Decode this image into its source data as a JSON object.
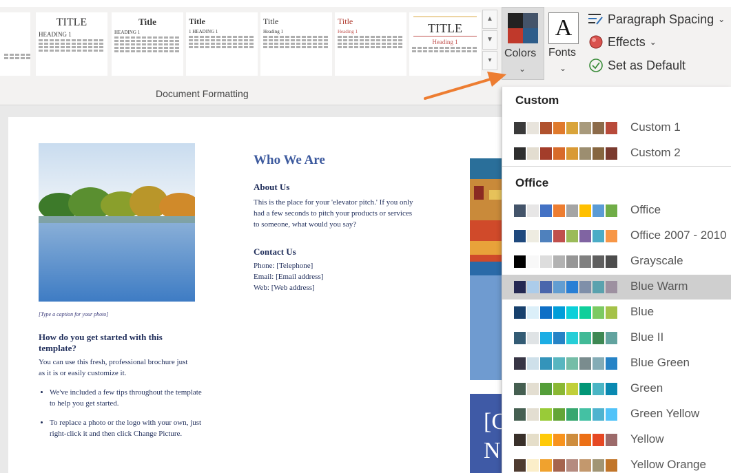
{
  "ribbon": {
    "style_gallery": [
      {
        "title": "TITLE",
        "heading": "HEADING 1"
      },
      {
        "title": "Title",
        "heading": "HEADING 1"
      },
      {
        "title": "Title",
        "heading": "1  HEADING 1"
      },
      {
        "title": "Title",
        "heading": "Heading 1"
      },
      {
        "title": "Title",
        "heading": "Heading 1"
      },
      {
        "title": "TITLE",
        "heading": "Heading 1"
      }
    ],
    "group_label": "Document Formatting",
    "colors_label": "Colors",
    "fonts_label": "Fonts",
    "paragraph_spacing_label": "Paragraph Spacing",
    "effects_label": "Effects",
    "set_default_label": "Set as Default"
  },
  "document": {
    "caption": "[Type a caption for your photo]",
    "started_heading": "How do you get started with this template?",
    "started_body": "You can use this fresh, professional brochure just as it is or easily customize it.",
    "bullets": [
      "We've included a few tips throughout the template to help you get started.",
      "To replace a photo or the logo with your own, just right-click it and then click Change Picture."
    ],
    "who_title": "Who We Are",
    "about_heading": "About Us",
    "about_body": "This is the place for your 'elevator pitch.' If you only had a few seconds to pitch your products or services to someone, what would you say?",
    "contact_heading": "Contact Us",
    "contact_lines": [
      "Phone: [Telephone]",
      "Email: [Email address]",
      "Web: [Web address]"
    ],
    "blue_block_text": "[C\nN"
  },
  "colors_dropdown": {
    "custom_heading": "Custom",
    "office_heading": "Office",
    "custom_themes": [
      {
        "name": "Custom 1",
        "colors": [
          "#3a3a3a",
          "#e8e4dc",
          "#b0522e",
          "#e07a2c",
          "#d9a43a",
          "#a89a7c",
          "#8c6b4a",
          "#b84a3a"
        ]
      },
      {
        "name": "Custom 2",
        "colors": [
          "#2e2e2e",
          "#e3ddd0",
          "#a33d2a",
          "#d86b2a",
          "#d99a35",
          "#9c8e70",
          "#86663f",
          "#7a3a2e"
        ]
      }
    ],
    "office_themes": [
      {
        "name": "Office",
        "colors": [
          "#44546a",
          "#e7e6e6",
          "#4472c4",
          "#ed7d31",
          "#a5a5a5",
          "#ffc000",
          "#5b9bd5",
          "#70ad47"
        ],
        "selected": false
      },
      {
        "name": "Office 2007 - 2010",
        "colors": [
          "#1f497d",
          "#eeece1",
          "#4f81bd",
          "#c0504d",
          "#9bbb59",
          "#8064a2",
          "#4bacc6",
          "#f79646"
        ],
        "selected": false
      },
      {
        "name": "Grayscale",
        "colors": [
          "#000000",
          "#f8f8f8",
          "#dddddd",
          "#b2b2b2",
          "#969696",
          "#808080",
          "#5f5f5f",
          "#4d4d4d"
        ],
        "selected": false
      },
      {
        "name": "Blue Warm",
        "colors": [
          "#242852",
          "#acccea",
          "#4a66ac",
          "#629dd1",
          "#297fd5",
          "#7f8fa9",
          "#5aa2ae",
          "#9d90a0"
        ],
        "selected": true
      },
      {
        "name": "Blue",
        "colors": [
          "#17406d",
          "#dbeff9",
          "#0f6fc6",
          "#009dd9",
          "#0bd0d9",
          "#10cf9b",
          "#7cca62",
          "#a5c249"
        ],
        "selected": false
      },
      {
        "name": "Blue II",
        "colors": [
          "#335b74",
          "#dfe3e5",
          "#1cade4",
          "#2683c6",
          "#27ced7",
          "#42ba97",
          "#3e8853",
          "#62a39f"
        ],
        "selected": false
      },
      {
        "name": "Blue Green",
        "colors": [
          "#373545",
          "#cee0ea",
          "#3494ba",
          "#58b6c0",
          "#75bda7",
          "#7a8c8e",
          "#84acb6",
          "#2683c6"
        ],
        "selected": false
      },
      {
        "name": "Green",
        "colors": [
          "#455f51",
          "#e3ded1",
          "#549e39",
          "#8ab833",
          "#c0cf3a",
          "#029676",
          "#4ab5c4",
          "#0989b1"
        ],
        "selected": false
      },
      {
        "name": "Green Yellow",
        "colors": [
          "#455f51",
          "#e3ded1",
          "#99cb38",
          "#63a537",
          "#37a76f",
          "#44c1a3",
          "#4eb3cf",
          "#51c3f9"
        ],
        "selected": false
      },
      {
        "name": "Yellow",
        "colors": [
          "#39302a",
          "#e5dec9",
          "#ffca08",
          "#f8931d",
          "#ce8d3e",
          "#ec7016",
          "#e64823",
          "#9c6a6a"
        ],
        "selected": false
      },
      {
        "name": "Yellow Orange",
        "colors": [
          "#4e3b30",
          "#fbeec9",
          "#f0a22e",
          "#a5644e",
          "#b58b80",
          "#c3986d",
          "#a19574",
          "#c17529"
        ],
        "selected": false
      }
    ]
  },
  "colors": {
    "accent_arrow": "#ed7d31",
    "heading_blue": "#3d5a9e",
    "selection_gray": "#cfcfcf"
  }
}
